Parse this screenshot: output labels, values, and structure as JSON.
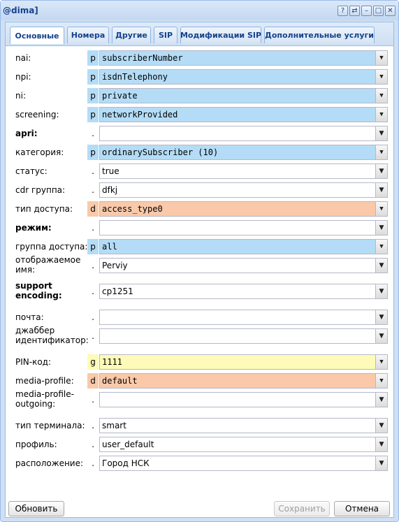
{
  "window": {
    "title": "@dima]"
  },
  "titlebar_buttons": [
    {
      "name": "help-icon",
      "glyph": "?"
    },
    {
      "name": "refresh-icon",
      "glyph": "⇄"
    },
    {
      "name": "minimize-icon",
      "glyph": "–"
    },
    {
      "name": "maximize-icon",
      "glyph": "□"
    },
    {
      "name": "close-icon",
      "glyph": "✕"
    }
  ],
  "tabs": [
    {
      "label": "Основные",
      "active": true
    },
    {
      "label": "Номера"
    },
    {
      "label": "Другие"
    },
    {
      "label": "SIP"
    },
    {
      "label": "Модификации SIP"
    },
    {
      "label": "Дополнительные услуги"
    }
  ],
  "fields": [
    {
      "label": "nai:",
      "flag": "p",
      "value": "subscriberNumber",
      "highlight": "blue",
      "mono": true
    },
    {
      "label": "npi:",
      "flag": "p",
      "value": "isdnTelephony",
      "highlight": "blue",
      "mono": true
    },
    {
      "label": "ni:",
      "flag": "p",
      "value": "private",
      "highlight": "blue",
      "mono": true
    },
    {
      "label": "screening:",
      "flag": "p",
      "value": "networkProvided",
      "highlight": "blue",
      "mono": true
    },
    {
      "label": "apri:",
      "flag": ".",
      "value": "",
      "bold": true
    },
    {
      "label": "категория:",
      "flag": "p",
      "value": "ordinarySubscriber (10)",
      "highlight": "blue",
      "mono": true
    },
    {
      "label": "статус:",
      "flag": ".",
      "value": "true"
    },
    {
      "label": "cdr группа:",
      "flag": ".",
      "value": "dfkj"
    },
    {
      "label": "тип доступа:",
      "flag": "d",
      "value": "access_type0",
      "highlight": "orange",
      "mono": true
    },
    {
      "label": "режим:",
      "flag": ".",
      "value": "",
      "bold": true
    },
    {
      "label": "группа доступа:",
      "flag": "p",
      "value": "all",
      "highlight": "blue",
      "mono": true
    },
    {
      "label": "отображаемое имя:",
      "flag": ".",
      "value": "Perviy"
    },
    {
      "label": "support encoding:",
      "flag": ".",
      "value": "cp1251",
      "bold": true
    },
    {
      "label": "почта:",
      "flag": ".",
      "value": ""
    },
    {
      "label": "джаббер идентификатор:",
      "flag": ".",
      "value": ""
    },
    {
      "label": "PIN-код:",
      "flag": "g",
      "value": "1111",
      "highlight": "yellow",
      "mono": true
    },
    {
      "label": "media-profile:",
      "flag": "d",
      "value": "default",
      "highlight": "orange",
      "mono": true
    },
    {
      "label": "media-profile-outgoing:",
      "flag": ".",
      "value": ""
    },
    {
      "label": "тип терминала:",
      "flag": ".",
      "value": "smart"
    },
    {
      "label": "профиль:",
      "flag": ".",
      "value": "user_default"
    },
    {
      "label": "расположение:",
      "flag": ".",
      "value": "Город НСК"
    }
  ],
  "buttons": {
    "refresh": "Обновить",
    "save": "Сохранить",
    "cancel": "Отмена"
  }
}
